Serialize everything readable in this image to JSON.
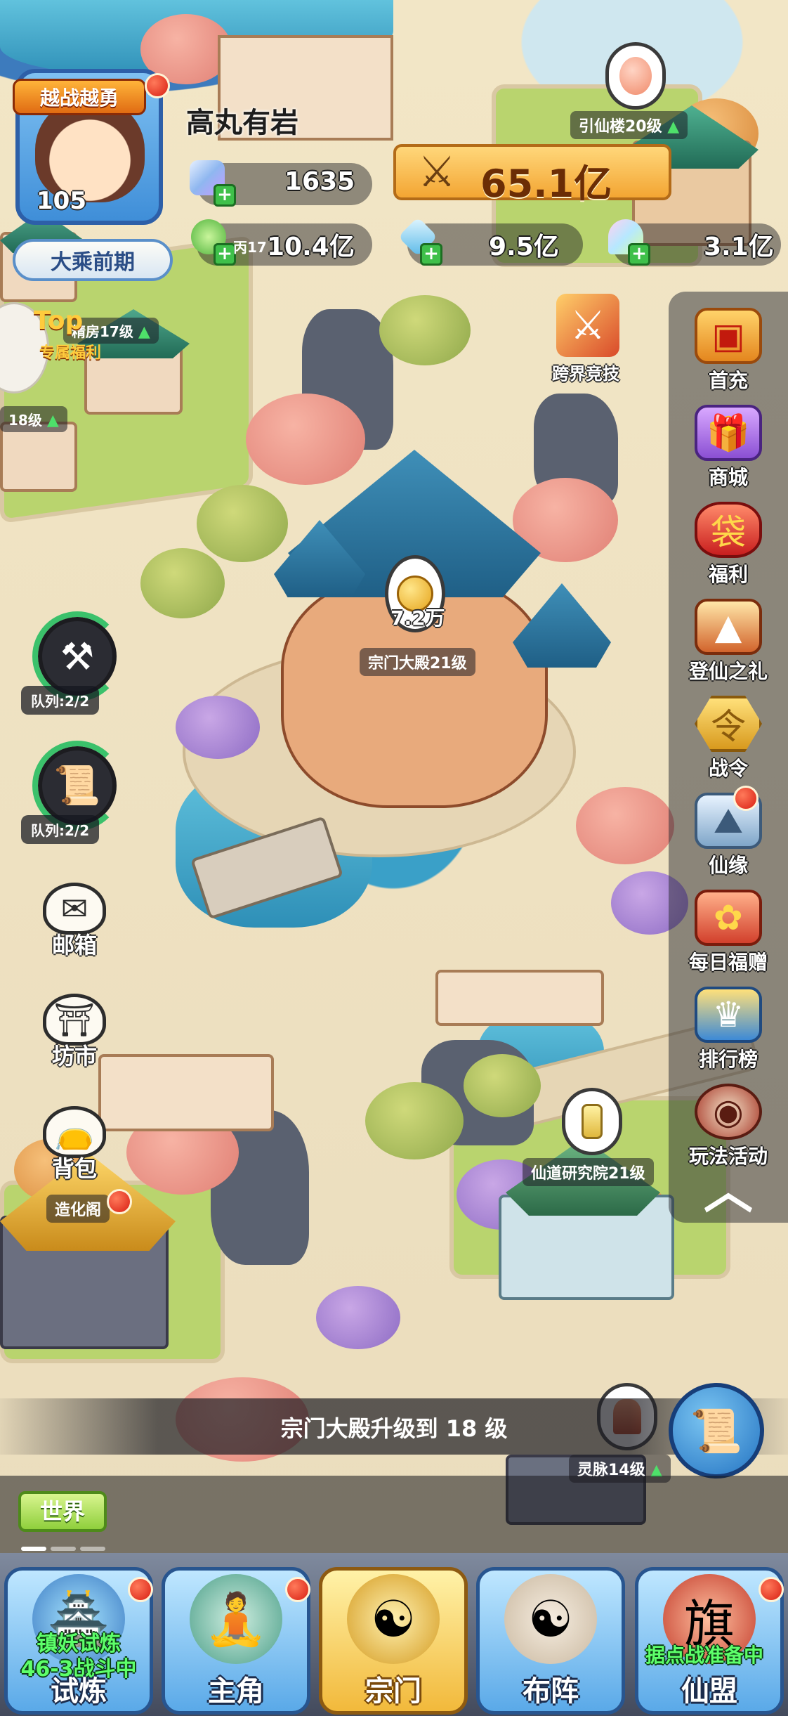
{
  "player": {
    "title_badge": "越战越勇",
    "level": "105",
    "realm": "大乘前期",
    "name": "高丸有岩"
  },
  "resources": {
    "jade": "1635",
    "power": "65.1亿",
    "spirit_stone": "10.4亿",
    "spirit_stone_tag": "丙17",
    "crystal": "9.5亿",
    "rainbow": "3.1亿"
  },
  "buildings": {
    "yinxian_tower": "引仙楼20级",
    "sect_hall": "宗门大殿21级",
    "sect_hall_reward": "7.2万",
    "research_institute": "仙道研究院21级",
    "lingmai": "灵脉14级",
    "zaohua_pavilion": "造化阁",
    "left_building_1": "精房17级",
    "left_building_2": "18级"
  },
  "event_banner": {
    "line1": "Top",
    "line2": "专属福利"
  },
  "cross_server": "跨界竞技",
  "queues": {
    "queue1": "队列:2/2",
    "queue2": "队列:2/2"
  },
  "left_utils": {
    "mail": "邮箱",
    "market": "坊市",
    "bag": "背包"
  },
  "right_menu": {
    "first_charge": "首充",
    "shop": "商城",
    "welfare": "福利",
    "ascend_gift": "登仙之礼",
    "battle_pass": "战令",
    "fate": "仙缘",
    "daily_gift": "每日福赠",
    "ranking": "排行榜",
    "activities": "玩法活动",
    "collapse_icon": "chevron-up-icon"
  },
  "notice": {
    "prefix": "宗门大殿升级到",
    "level": "18",
    "suffix": "级"
  },
  "world_chat": {
    "tag": "世界"
  },
  "bottom_nav": {
    "trial": {
      "label": "试炼",
      "status_line1": "镇妖试炼",
      "status_line2": "46-3战斗中"
    },
    "hero": {
      "label": "主角"
    },
    "sect": {
      "label": "宗门"
    },
    "formation": {
      "label": "布阵"
    },
    "alliance": {
      "label": "仙盟",
      "status": "据点战准备中"
    }
  },
  "colors": {
    "accent_gold": "#f3a533",
    "active_tab": "#f2b93b",
    "tab_blue": "#5aa9e8",
    "status_green": "#5dff6a",
    "notify_red": "#d81e12"
  }
}
